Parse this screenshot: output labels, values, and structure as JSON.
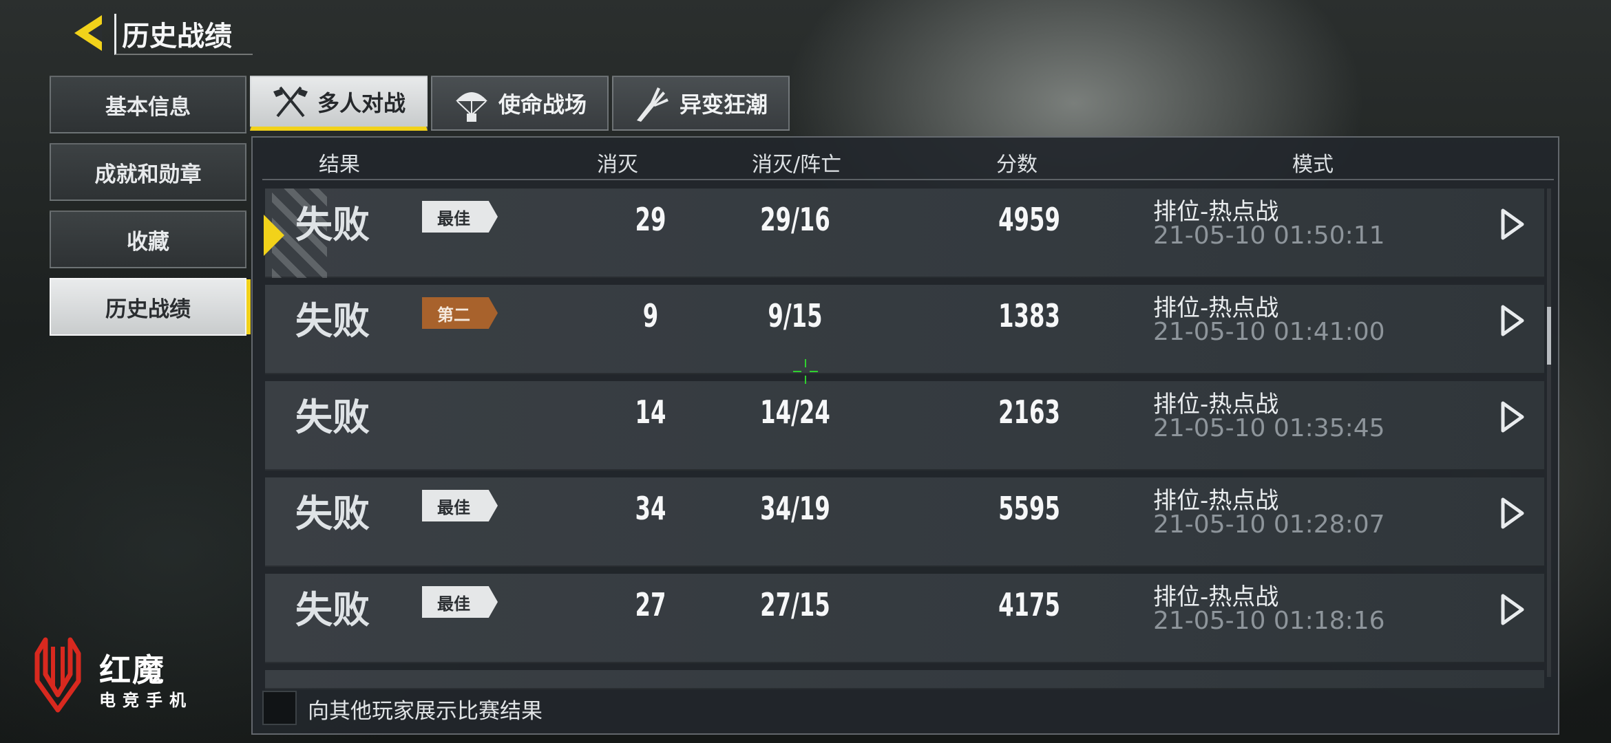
{
  "header": {
    "title": "历史战绩"
  },
  "sidebar": {
    "items": [
      {
        "label": "基本信息"
      },
      {
        "label": "成就和勋章"
      },
      {
        "label": "收藏"
      },
      {
        "label": "历史战绩",
        "active": true
      }
    ]
  },
  "tabs": [
    {
      "label": "多人对战",
      "icon": "crossed-flags-icon",
      "active": true
    },
    {
      "label": "使命战场",
      "icon": "parachute-icon"
    },
    {
      "label": "异变狂潮",
      "icon": "claw-arm-icon"
    }
  ],
  "table": {
    "columns": [
      "结果",
      "消灭",
      "消灭/阵亡",
      "分数",
      "模式"
    ],
    "rows": [
      {
        "result": "失败",
        "badge": "最佳",
        "badge_type": "best",
        "kills": "29",
        "kd": "29/16",
        "score": "4959",
        "mode": "排位-热点战",
        "time": "21-05-10 01:50:11",
        "selected": true
      },
      {
        "result": "失败",
        "badge": "第二",
        "badge_type": "second",
        "kills": "9",
        "kd": "9/15",
        "score": "1383",
        "mode": "排位-热点战",
        "time": "21-05-10 01:41:00"
      },
      {
        "result": "失败",
        "badge": "",
        "badge_type": "",
        "kills": "14",
        "kd": "14/24",
        "score": "2163",
        "mode": "排位-热点战",
        "time": "21-05-10 01:35:45"
      },
      {
        "result": "失败",
        "badge": "最佳",
        "badge_type": "best",
        "kills": "34",
        "kd": "34/19",
        "score": "5595",
        "mode": "排位-热点战",
        "time": "21-05-10 01:28:07"
      },
      {
        "result": "失败",
        "badge": "最佳",
        "badge_type": "best",
        "kills": "27",
        "kd": "27/15",
        "score": "4175",
        "mode": "排位-热点战",
        "time": "21-05-10 01:18:16"
      }
    ]
  },
  "share": {
    "label": "向其他玩家展示比赛结果",
    "checked": false
  },
  "brand": {
    "name": "红魔",
    "sub": "电竞手机"
  },
  "colors": {
    "accent": "#f2d21a",
    "second_badge": "#a8622c",
    "brand_red": "#d8291f"
  }
}
